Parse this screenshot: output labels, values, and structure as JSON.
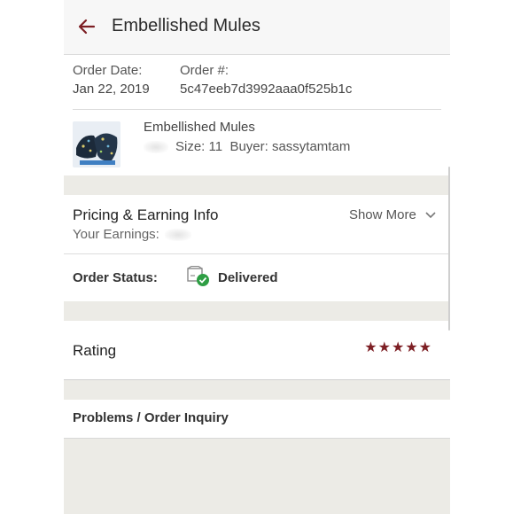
{
  "header": {
    "title": "Embellished Mules",
    "back_icon": "arrow-left-icon"
  },
  "order": {
    "date_label": "Order Date:",
    "date_value": "Jan 22, 2019",
    "number_label": "Order #:",
    "number_value": "5c47eeb7d3992aaa0f525b1c"
  },
  "item": {
    "title": "Embellished Mules",
    "size": "Size: 11",
    "buyer": "Buyer: sassytamtam"
  },
  "pricing": {
    "title": "Pricing & Earning Info",
    "earnings_label": "Your Earnings:",
    "show_more": "Show More"
  },
  "status": {
    "label": "Order Status:",
    "value": "Delivered",
    "icon": "box-check-icon"
  },
  "rating": {
    "label": "Rating",
    "stars": 5,
    "stars_text": "★★★★★"
  },
  "problems": {
    "label": "Problems / Order Inquiry"
  },
  "colors": {
    "accent": "#7d1f24",
    "background": "#ecebe6",
    "check": "#2e9e44"
  }
}
